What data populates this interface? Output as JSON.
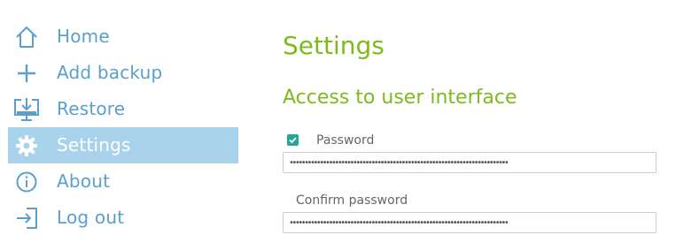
{
  "sidebar": {
    "items": [
      {
        "label": "Home",
        "icon": "home-icon",
        "active": false
      },
      {
        "label": "Add backup",
        "icon": "plus-icon",
        "active": false
      },
      {
        "label": "Restore",
        "icon": "restore-icon",
        "active": false
      },
      {
        "label": "Settings",
        "icon": "gear-icon",
        "active": true
      },
      {
        "label": "About",
        "icon": "info-icon",
        "active": false
      },
      {
        "label": "Log out",
        "icon": "logout-icon",
        "active": false
      }
    ]
  },
  "main": {
    "title": "Settings",
    "section_title": "Access to user interface",
    "password": {
      "checkbox_checked": true,
      "label": "Password",
      "value": "••••••••••••••••••••••••••••••••••••••••••••••••••••••••••••••••••••••••"
    },
    "confirm_password": {
      "label": "Confirm password",
      "value": "••••••••••••••••••••••••••••••••••••••••••••••••••••••••••••••••••••••••"
    }
  },
  "colors": {
    "accent_green": "#7dbb1d",
    "nav_blue": "#5ba0cb",
    "active_bg": "#a9d3ec",
    "checkbox_teal": "#26a69a"
  }
}
